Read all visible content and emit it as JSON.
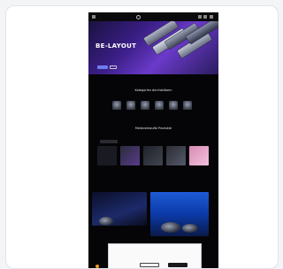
{
  "header": {
    "brand": "",
    "nav": [
      "",
      "",
      ""
    ]
  },
  "hero": {
    "title": "BE-LAYOUT",
    "subtitle": ""
  },
  "categories": {
    "title": "Kategorien durchstöbern",
    "items": [
      {
        "label": ""
      },
      {
        "label": ""
      },
      {
        "label": ""
      },
      {
        "label": ""
      },
      {
        "label": ""
      },
      {
        "label": ""
      }
    ]
  },
  "bestsellers": {
    "title": "Meistverkaufte Produkte",
    "tabs": [
      "",
      "",
      "",
      "",
      ""
    ],
    "products": [
      {
        "name": "",
        "price": ""
      },
      {
        "name": "",
        "price": ""
      },
      {
        "name": "",
        "price": ""
      },
      {
        "name": "",
        "price": ""
      },
      {
        "name": "",
        "price": ""
      }
    ]
  },
  "promos": {
    "left": {
      "tag": "",
      "title": ""
    },
    "right": {
      "tag": "",
      "title": ""
    }
  },
  "cookie_banner": {
    "title": "",
    "text": "",
    "settings_label": "",
    "reject_label": "",
    "accept_label": ""
  },
  "colors": {
    "page_bg": "#050507",
    "hero_accent": "#6a3ac9",
    "cta": "#6f7df0",
    "promo_blue": "#1f5bd6",
    "chat_bubble": "#f29a1a"
  }
}
